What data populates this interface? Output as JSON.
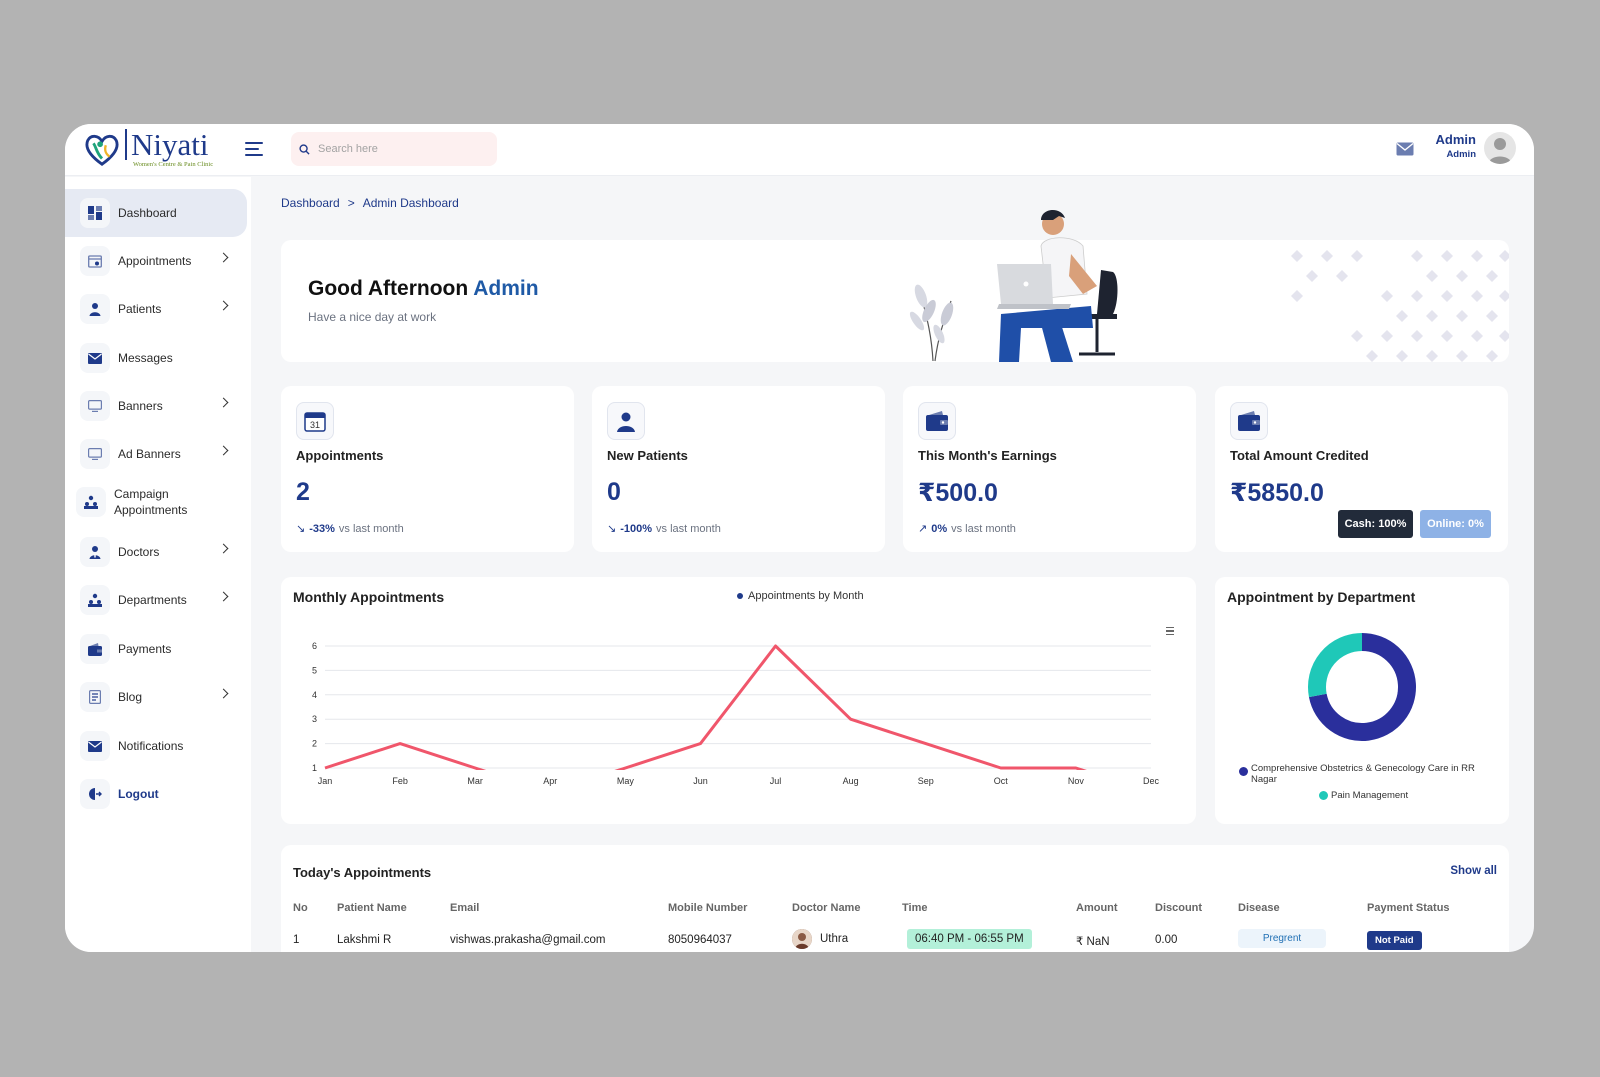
{
  "brand": {
    "name": "Niyati",
    "tagline": "Women's Centre & Pain Clinic"
  },
  "search": {
    "placeholder": "Search here"
  },
  "user": {
    "name": "Admin",
    "role": "Admin"
  },
  "sidebar": {
    "items": [
      {
        "label": "Dashboard",
        "icon": "dashboard-icon",
        "active": true,
        "has_submenu": false
      },
      {
        "label": "Appointments",
        "icon": "calendar-icon",
        "has_submenu": true
      },
      {
        "label": "Patients",
        "icon": "user-icon",
        "has_submenu": true
      },
      {
        "label": "Messages",
        "icon": "envelope-icon",
        "has_submenu": false
      },
      {
        "label": "Banners",
        "icon": "monitor-icon",
        "has_submenu": true
      },
      {
        "label": "Ad Banners",
        "icon": "monitor-icon",
        "has_submenu": true
      },
      {
        "label": "Campaign Appointments",
        "icon": "group-icon",
        "has_submenu": false
      },
      {
        "label": "Doctors",
        "icon": "doctor-icon",
        "has_submenu": true
      },
      {
        "label": "Departments",
        "icon": "group-icon",
        "has_submenu": true
      },
      {
        "label": "Payments",
        "icon": "wallet-icon",
        "has_submenu": false
      },
      {
        "label": "Blog",
        "icon": "document-icon",
        "has_submenu": true
      },
      {
        "label": "Notifications",
        "icon": "envelope-icon",
        "has_submenu": false
      },
      {
        "label": "Logout",
        "icon": "logout-icon",
        "has_submenu": false
      }
    ]
  },
  "breadcrumb": {
    "root": "Dashboard",
    "separator": ">",
    "current": "Admin Dashboard"
  },
  "welcome": {
    "greeting": "Good Afternoon",
    "name": "Admin",
    "subtitle": "Have a nice day at work"
  },
  "stats": [
    {
      "label": "Appointments",
      "value": "2",
      "change": "-33%",
      "change_suffix": "vs last month",
      "direction": "down",
      "icon": "calendar-icon",
      "calendar_day": "31"
    },
    {
      "label": "New Patients",
      "value": "0",
      "change": "-100%",
      "change_suffix": "vs last month",
      "direction": "down",
      "icon": "user-icon"
    },
    {
      "label": "This Month's Earnings",
      "value": "₹500.0",
      "change": "0%",
      "change_suffix": "vs last month",
      "direction": "up",
      "icon": "wallet-icon"
    },
    {
      "label": "Total Amount Credited",
      "value": "₹5850.0",
      "icon": "wallet-icon",
      "cash_label": "Cash: 100%",
      "online_label": "Online: 0%"
    }
  ],
  "monthly_chart": {
    "title": "Monthly Appointments",
    "legend": "Appointments by Month",
    "menu_icon": "hamburger-icon"
  },
  "dept_chart": {
    "title": "Appointment by Department",
    "legend": [
      {
        "label": "Comprehensive Obstetrics & Genecology Care in RR Nagar",
        "color": "#2a2f9c"
      },
      {
        "label": "Pain Management",
        "color": "#1fc8b8"
      }
    ]
  },
  "chart_data": [
    {
      "type": "line",
      "title": "Monthly Appointments",
      "categories": [
        "Jan",
        "Feb",
        "Mar",
        "Apr",
        "May",
        "Jun",
        "Jul",
        "Aug",
        "Sep",
        "Oct",
        "Nov",
        "Dec"
      ],
      "series": [
        {
          "name": "Appointments by Month",
          "values": [
            1,
            2,
            1,
            0,
            1,
            2,
            6,
            3,
            2,
            1,
            1,
            0
          ],
          "color": "#f0566b"
        }
      ],
      "ylim": [
        1,
        6
      ],
      "yticks": [
        1,
        2,
        3,
        4,
        5,
        6
      ],
      "grid": true,
      "legend_position": "top"
    },
    {
      "type": "pie",
      "title": "Appointment by Department",
      "categories": [
        "Comprehensive Obstetrics & Genecology Care in RR Nagar",
        "Pain Management"
      ],
      "values": [
        72,
        28
      ],
      "colors": [
        "#2a2f9c",
        "#1fc8b8"
      ],
      "legend_position": "bottom"
    }
  ],
  "appointments_table": {
    "title": "Today's Appointments",
    "show_all": "Show all",
    "columns": [
      "No",
      "Patient Name",
      "Email",
      "Mobile Number",
      "Doctor Name",
      "Time",
      "Amount",
      "Discount",
      "Disease",
      "Payment Status"
    ],
    "rows": [
      {
        "no": "1",
        "patient": "Lakshmi R",
        "email": "vishwas.prakasha@gmail.com",
        "mobile": "8050964037",
        "doctor": "Uthra",
        "time": "06:40 PM - 06:55 PM",
        "amount": "₹ NaN",
        "discount": "0.00",
        "disease": "Pregrent",
        "status": "Not Paid"
      }
    ]
  }
}
